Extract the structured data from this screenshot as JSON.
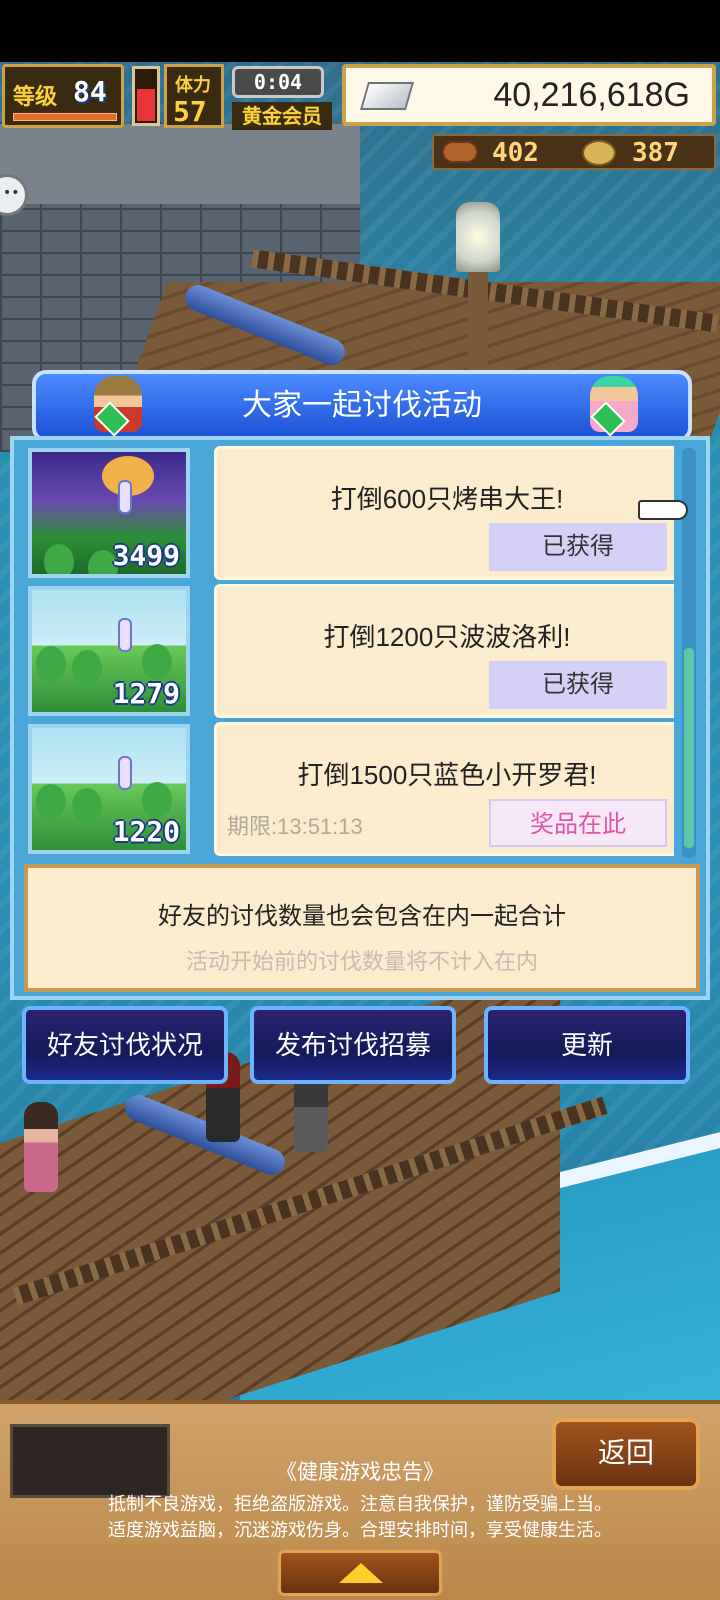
{
  "hud": {
    "level_label": "等级",
    "level_value": "84",
    "stamina_label": "体力",
    "stamina_value": "57",
    "stamina_fraction": 0.6,
    "timer": "0:04",
    "membership": "黄金会员",
    "money": "40,216,618G",
    "meat": "402",
    "grass": "387"
  },
  "dialog": {
    "title": "大家一起讨伐活动",
    "missions": [
      {
        "title": "打倒600只烤串大王!",
        "status": "已获得",
        "count": "3499",
        "deadline": ""
      },
      {
        "title": "打倒1200只波波洛利!",
        "status": "已获得",
        "count": "1279",
        "deadline": ""
      },
      {
        "title": "打倒1500只蓝色小开罗君!",
        "status": "奖品在此",
        "count": "1220",
        "deadline": "期限:13:51:13"
      }
    ],
    "note_main": "好友的讨伐数量也会包含在内一起合计",
    "note_sub": "活动开始前的讨伐数量将不计入在内"
  },
  "actions": {
    "friends_status": "好友讨伐状况",
    "post_recruit": "发布讨伐招募",
    "refresh": "更新"
  },
  "bottom": {
    "back": "返回",
    "health_title": "《健康游戏忠告》",
    "health_line1": "抵制不良游戏，拒绝盗版游戏。注意自我保护，谨防受骗上当。",
    "health_line2": "适度游戏益脑，沉迷游戏伤身。合理安排时间，享受健康生活。"
  },
  "icons": {
    "silver": "silver-bar-icon",
    "meat": "meat-icon",
    "grass": "medal-icon",
    "chat": "chat-bubble-icon",
    "pointer": "pointing-hand-icon",
    "expand": "chevron-up-icon"
  },
  "colors": {
    "title_blue": "#1d52d6",
    "card_bg": "#fbeccd",
    "obtained_btn": "#d4d0f8",
    "prize_text": "#e055a8",
    "action_btn": "#141a5a"
  }
}
